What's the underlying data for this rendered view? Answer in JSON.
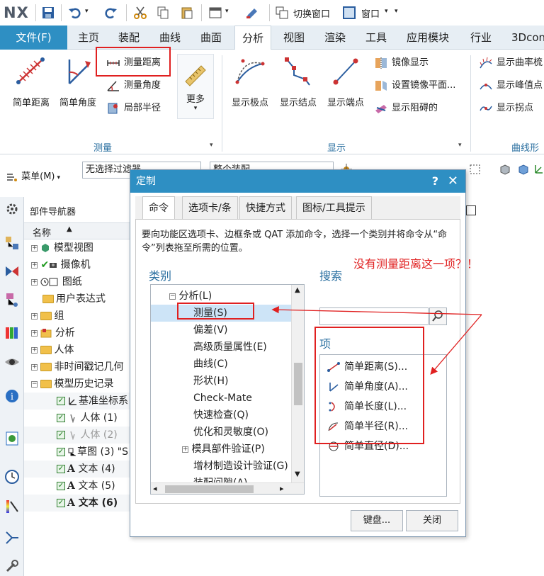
{
  "app": {
    "logo": "NX"
  },
  "qat": {
    "switch_window": "切换窗口",
    "window": "窗口"
  },
  "tabs": {
    "file": "文件(F)",
    "items": [
      "主页",
      "装配",
      "曲线",
      "曲面",
      "分析",
      "视图",
      "渲染",
      "工具",
      "应用模块",
      "行业",
      "3Dcon"
    ],
    "active": "分析"
  },
  "ribbon": {
    "measure": {
      "simple_distance": "简单距离",
      "simple_angle": "简单角度",
      "measure_distance": "测量距离",
      "measure_angle": "测量角度",
      "local_radius": "局部半径",
      "more": "更多",
      "group_label": "测量"
    },
    "display": {
      "show_poles": "显示极点",
      "show_knots": "显示结点",
      "show_endpoints": "显示端点",
      "mirror_display": "镜像显示",
      "set_mirror_plane": "设置镜像平面...",
      "show_blocking": "显示阻碍的",
      "group_label": "显示"
    },
    "curve_shape": {
      "show_curvature": "显示曲率梳",
      "show_peaks": "显示峰值点",
      "show_inflections": "显示拐点",
      "group_label": "曲线形状"
    }
  },
  "toolbar2": {
    "menu": "菜单(M)",
    "filter": "无选择过滤器",
    "assembly": "整个装配"
  },
  "navigator": {
    "title": "部件导航器",
    "col_name": "名称",
    "rows": [
      {
        "label": "模型视图"
      },
      {
        "label": "摄像机"
      },
      {
        "label": "图纸"
      },
      {
        "label": "用户表达式"
      },
      {
        "label": "组"
      },
      {
        "label": "分析"
      },
      {
        "label": "人体"
      },
      {
        "label": "非时间戳记几何"
      },
      {
        "label": "模型历史记录"
      },
      {
        "label": "基准坐标系"
      },
      {
        "label": "人体 (1)"
      },
      {
        "label": "人体 (2)"
      },
      {
        "label": "草图 (3) \"S"
      },
      {
        "label": "文本 (4)"
      },
      {
        "label": "文本 (5)"
      },
      {
        "label": "文本 (6)"
      }
    ]
  },
  "dialog": {
    "title": "定制",
    "help": "?",
    "tabs": [
      "命令",
      "选项卡/条",
      "快捷方式",
      "图标/工具提示"
    ],
    "description": "要向功能区选项卡、边框条或 QAT 添加命令，选择一个类别并将命令从“命令”列表拖至所需的位置。",
    "category_label": "类别",
    "search_label": "搜索",
    "items_label": "项",
    "categories": [
      {
        "label": "分析(L)"
      },
      {
        "label": "测量(S)"
      },
      {
        "label": "偏差(V)"
      },
      {
        "label": "高级质量属性(E)"
      },
      {
        "label": "曲线(C)"
      },
      {
        "label": "形状(H)"
      },
      {
        "label": "Check-Mate"
      },
      {
        "label": "快速检查(Q)"
      },
      {
        "label": "优化和灵敏度(O)"
      },
      {
        "label": "模具部件验证(P)"
      },
      {
        "label": "增材制造设计验证(G)"
      },
      {
        "label": "装配间隙(A)"
      }
    ],
    "items": [
      {
        "label": "简单距离(S)..."
      },
      {
        "label": "简单角度(A)..."
      },
      {
        "label": "简单长度(L)..."
      },
      {
        "label": "简单半径(R)..."
      },
      {
        "label": "简单直径(D)..."
      }
    ],
    "keyboard_button": "键盘...",
    "close_button": "关闭"
  },
  "annotation": {
    "text": "没有测量距离这一项？！"
  },
  "colors": {
    "accent": "#2e8fc3",
    "annotation": "#e02020",
    "folder": "#f1c04a"
  }
}
